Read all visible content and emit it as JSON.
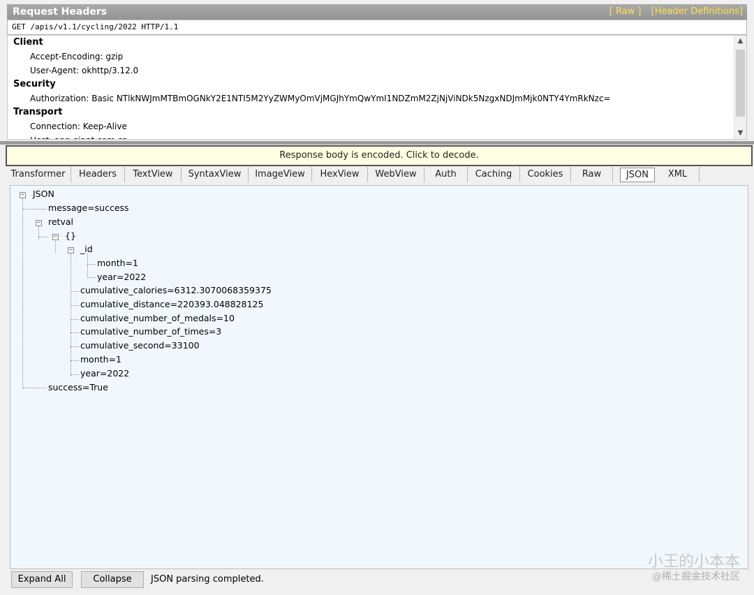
{
  "request": {
    "title": "Request Headers",
    "link_raw": "[ Raw ]",
    "link_defs": "[Header Definitions]",
    "request_line": "GET /apis/v1.1/cycling/2022 HTTP/1.1",
    "groups": [
      {
        "name": "Client",
        "headers": [
          "Accept-Encoding: gzip",
          "User-Agent: okhttp/3.12.0"
        ]
      },
      {
        "name": "Security",
        "headers": [
          "Authorization: Basic NTlkNWJmMTBmOGNkY2E1NTI5M2YyZWMyOmVjMGJhYmQwYmI1NDZmM2ZjNjViNDk5NzgxNDJmMjk0NTY4YmRkNzc="
        ]
      },
      {
        "name": "Transport",
        "headers": [
          "Connection: Keep-Alive",
          "Host: app.giant.com.cn"
        ]
      }
    ]
  },
  "banner": "Response body is encoded. Click to decode.",
  "tabs": [
    "Transformer",
    "Headers",
    "TextView",
    "SyntaxView",
    "ImageView",
    "HexView",
    "WebView",
    "Auth",
    "Caching",
    "Cookies",
    "Raw",
    "JSON",
    "XML"
  ],
  "active_tab": "JSON",
  "tree": {
    "root": "JSON",
    "message": "message=success",
    "retval": "retval",
    "obj": "{}",
    "id": "_id",
    "id_month": "month=1",
    "id_year": "year=2022",
    "cal": "cumulative_calories=6312.3070068359375",
    "dist": "cumulative_distance=220393.048828125",
    "medals": "cumulative_number_of_medals=10",
    "times": "cumulative_number_of_times=3",
    "second": "cumulative_second=33100",
    "month": "month=1",
    "year": "year=2022",
    "success": "success=True"
  },
  "bottom": {
    "expand_all": "Expand All",
    "collapse": "Collapse",
    "status": "JSON parsing completed."
  },
  "watermark": {
    "line1": "小王的小本本",
    "line2": "@稀土掘金技术社区"
  }
}
